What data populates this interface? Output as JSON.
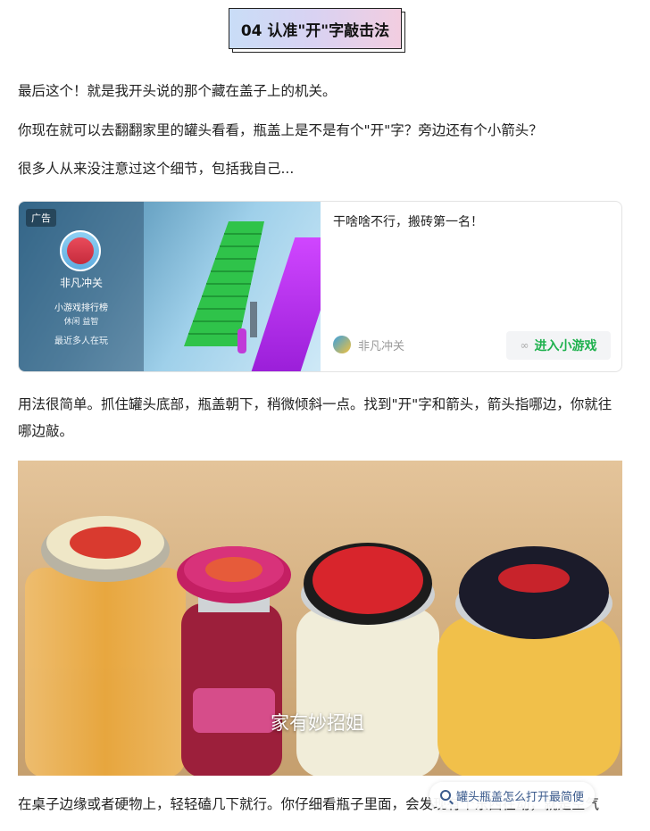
{
  "section": {
    "heading": "04 认准\"开\"字敲击法"
  },
  "paragraphs": {
    "p1": "最后这个！就是我开头说的那个藏在盖子上的机关。",
    "p2": "你现在就可以去翻翻家里的罐头看看，瓶盖上是不是有个\"开\"字？旁边还有个小箭头？",
    "p3": "很多人从来没注意过这个细节，包括我自己...",
    "p4": "用法很简单。抓住罐头底部，瓶盖朝下，稍微倾斜一点。找到\"开\"字和箭头，箭头指哪边，你就往哪边敲。",
    "p5": "在桌子边缘或者硬物上，轻轻磕几下就行。你仔细看瓶子里面，会发现有个东西在动，就是空气"
  },
  "ad": {
    "tag": "广告",
    "brand": "非凡冲关",
    "rank_label": "小游戏排行榜",
    "tags": "休闲   益智",
    "recent": "最近多人在玩",
    "title": "干啥啥不行，搬砖第一名！",
    "account_name": "非凡冲关",
    "cta": "进入小游戏"
  },
  "photo": {
    "watermark": "家有妙招姐"
  },
  "search_chip": {
    "label": "罐头瓶盖怎么打开最简便"
  },
  "colors": {
    "cta_green": "#1eb14d",
    "heading_gradient": [
      "#c9ddf7",
      "#f2cde0"
    ]
  }
}
